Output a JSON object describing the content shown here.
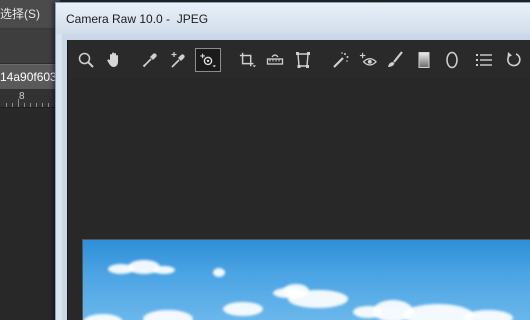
{
  "photoshop": {
    "menu_select_label": "选择(S)",
    "doc_tab_label": "14a90f603",
    "ruler_number": "8"
  },
  "camera_raw": {
    "window_title": "Camera Raw 10.0 -  JPEG",
    "toolbar": [
      {
        "name": "zoom-tool",
        "icon": "magnifier-icon",
        "active": false
      },
      {
        "name": "hand-tool",
        "icon": "hand-icon",
        "active": false
      },
      {
        "name": "white-balance-tool",
        "icon": "eyedropper-icon",
        "active": false
      },
      {
        "name": "color-sampler-tool",
        "icon": "color-sampler-icon",
        "active": false
      },
      {
        "name": "targeted-adjustment-tool",
        "icon": "targeted-adjustment-icon",
        "active": true
      },
      {
        "name": "crop-tool",
        "icon": "crop-icon",
        "active": false
      },
      {
        "name": "straighten-tool",
        "icon": "straighten-icon",
        "active": false
      },
      {
        "name": "transform-tool",
        "icon": "transform-icon",
        "active": false
      },
      {
        "name": "spot-removal-tool",
        "icon": "spot-removal-icon",
        "active": false
      },
      {
        "name": "red-eye-tool",
        "icon": "red-eye-icon",
        "active": false
      },
      {
        "name": "adjustment-brush-tool",
        "icon": "brush-icon",
        "active": false
      },
      {
        "name": "graduated-filter-tool",
        "icon": "graduated-filter-icon",
        "active": false
      },
      {
        "name": "radial-filter-tool",
        "icon": "radial-filter-icon",
        "active": false
      },
      {
        "name": "preferences-tool",
        "icon": "list-icon",
        "active": false
      },
      {
        "name": "rotate-tool",
        "icon": "rotate-icon",
        "active": false
      }
    ]
  },
  "colors": {
    "dialog_bg": "#262626",
    "titlebar": "#dde7f3",
    "sky": "#3d9ae0"
  }
}
